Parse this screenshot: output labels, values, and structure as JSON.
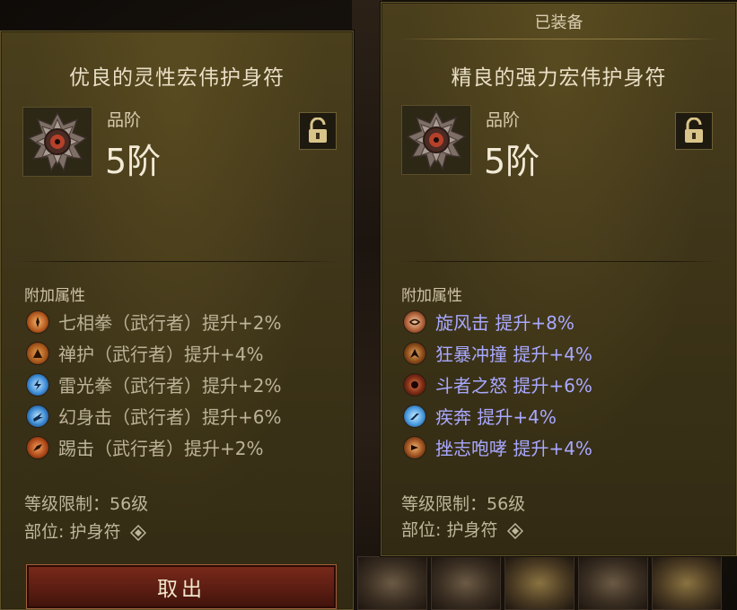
{
  "colors": {
    "panel_bg": "#40361a",
    "title_text": "#e9dfc6",
    "affix_inactive": "#bcb398",
    "affix_magic": "#a8a8ff",
    "button_red": "#5c1d12"
  },
  "left_item": {
    "title": "优良的灵性宏伟护身符",
    "tier_label": "品阶",
    "tier_value": "5阶",
    "icon": "amulet-icon",
    "section_header": "附加属性",
    "affixes": [
      {
        "text": "七相拳（武行者）提升+2%",
        "icon": "seven-sided-strike-icon"
      },
      {
        "text": "禅护（武行者）提升+4%",
        "icon": "serenity-icon"
      },
      {
        "text": "雷光拳（武行者）提升+2%",
        "icon": "fists-of-thunder-icon"
      },
      {
        "text": "幻身击（武行者）提升+6%",
        "icon": "dashing-strike-icon"
      },
      {
        "text": "踢击（武行者）提升+2%",
        "icon": "kick-icon"
      }
    ],
    "level_req": "等级限制：56级",
    "slot": "部位: 护身符",
    "remove_button": "取出"
  },
  "right_item": {
    "equipped_label": "已装备",
    "title": "精良的强力宏伟护身符",
    "tier_label": "品阶",
    "tier_value": "5阶",
    "icon": "amulet-icon",
    "section_header": "附加属性",
    "affixes": [
      {
        "text": "旋风击 提升+8%",
        "icon": "whirlwind-icon"
      },
      {
        "text": "狂暴冲撞 提升+4%",
        "icon": "furious-charge-icon"
      },
      {
        "text": "斗者之怒 提升+6%",
        "icon": "battle-rage-icon"
      },
      {
        "text": "疾奔 提升+4%",
        "icon": "sprint-icon"
      },
      {
        "text": "挫志咆哮 提升+4%",
        "icon": "threatening-shout-icon"
      }
    ],
    "level_req": "等级限制：56级",
    "slot": "部位: 护身符"
  }
}
